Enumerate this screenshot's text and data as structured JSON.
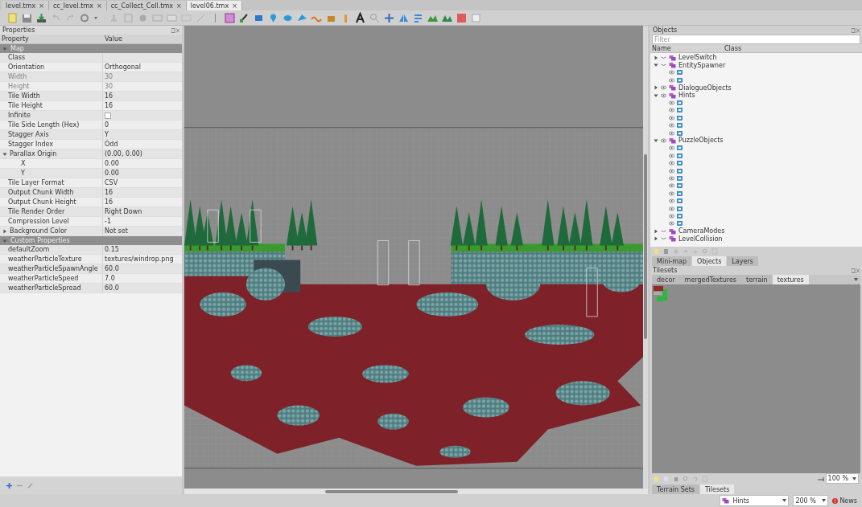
{
  "tabs": [
    {
      "label": "level.tmx",
      "close": "×",
      "selected": false
    },
    {
      "label": "cc_level.tmx",
      "close": "×",
      "selected": false
    },
    {
      "label": "cc_Collect_Cell.tmx",
      "close": "×",
      "selected": false
    },
    {
      "label": "level06.tmx",
      "close": "×",
      "selected": true
    }
  ],
  "properties": {
    "title": "Properties",
    "columns": [
      "Property",
      "Value"
    ],
    "rows": [
      {
        "kind": "group",
        "name": "Map",
        "expanded": true
      },
      {
        "kind": "prop",
        "name": "Class",
        "value": "",
        "disabled": false
      },
      {
        "kind": "prop",
        "name": "Orientation",
        "value": "Orthogonal",
        "disabled": false
      },
      {
        "kind": "prop",
        "name": "Width",
        "value": "30",
        "disabled": true
      },
      {
        "kind": "prop",
        "name": "Height",
        "value": "30",
        "disabled": true
      },
      {
        "kind": "prop",
        "name": "Tile Width",
        "value": "16",
        "disabled": false
      },
      {
        "kind": "prop",
        "name": "Tile Height",
        "value": "16",
        "disabled": false
      },
      {
        "kind": "check",
        "name": "Infinite",
        "checked": false,
        "disabled": false
      },
      {
        "kind": "prop",
        "name": "Tile Side Length (Hex)",
        "value": "0",
        "disabled": false
      },
      {
        "kind": "prop",
        "name": "Stagger Axis",
        "value": "Y",
        "disabled": false
      },
      {
        "kind": "prop",
        "name": "Stagger Index",
        "value": "Odd",
        "disabled": false
      },
      {
        "kind": "prop",
        "name": "Parallax Origin",
        "value": "(0.00, 0.00)",
        "disabled": false,
        "expanded": true
      },
      {
        "kind": "sub",
        "name": "X",
        "value": "0.00",
        "disabled": false
      },
      {
        "kind": "sub",
        "name": "Y",
        "value": "0.00",
        "disabled": false
      },
      {
        "kind": "prop",
        "name": "Tile Layer Format",
        "value": "CSV",
        "disabled": false
      },
      {
        "kind": "prop",
        "name": "Output Chunk Width",
        "value": "16",
        "disabled": false
      },
      {
        "kind": "prop",
        "name": "Output Chunk Height",
        "value": "16",
        "disabled": false
      },
      {
        "kind": "prop",
        "name": "Tile Render Order",
        "value": "Right Down",
        "disabled": false
      },
      {
        "kind": "prop",
        "name": "Compression Level",
        "value": "-1",
        "disabled": false
      },
      {
        "kind": "prop",
        "name": "Background Color",
        "value": "Not set",
        "disabled": false,
        "expanded": false
      },
      {
        "kind": "group",
        "name": "Custom Properties",
        "expanded": true
      },
      {
        "kind": "prop",
        "name": "defaultZoom",
        "value": "0.15",
        "disabled": false
      },
      {
        "kind": "prop",
        "name": "weatherParticleTexture",
        "value": "textures/windrop.png",
        "disabled": false
      },
      {
        "kind": "prop",
        "name": "weatherParticleSpawnAngle",
        "value": "60.0",
        "disabled": false
      },
      {
        "kind": "prop",
        "name": "weatherParticleSpeed",
        "value": "7.0",
        "disabled": false
      },
      {
        "kind": "prop",
        "name": "weatherParticleSpread",
        "value": "60.0",
        "disabled": false
      }
    ]
  },
  "objects": {
    "title": "Objects",
    "filter_placeholder": "Filter",
    "columns": [
      "Name",
      "Class"
    ],
    "layers": [
      {
        "name": "LevelSwitch",
        "visible": false,
        "expanded": false
      },
      {
        "name": "EntitySpawner",
        "visible": false,
        "expanded": true,
        "children": [
          {
            "visible": true
          },
          {
            "visible": true
          }
        ]
      },
      {
        "name": "DialogueObjects",
        "visible": true,
        "expanded": false
      },
      {
        "name": "Hints",
        "visible": true,
        "expanded": true,
        "children": [
          {
            "visible": true
          },
          {
            "visible": true
          },
          {
            "visible": true
          },
          {
            "visible": true
          },
          {
            "visible": true
          }
        ]
      },
      {
        "name": "PuzzleObjects",
        "visible": true,
        "expanded": true,
        "children": [
          {
            "visible": true
          },
          {
            "visible": true
          },
          {
            "visible": true
          },
          {
            "visible": true
          },
          {
            "visible": true
          },
          {
            "visible": true
          },
          {
            "visible": true
          },
          {
            "visible": true
          },
          {
            "visible": true
          },
          {
            "visible": true
          },
          {
            "visible": true
          }
        ]
      },
      {
        "name": "CameraModes",
        "visible": false,
        "expanded": false
      },
      {
        "name": "LevelCollision",
        "visible": false,
        "expanded": false
      }
    ]
  },
  "panel_tabs": [
    {
      "label": "Mini-map",
      "selected": false
    },
    {
      "label": "Objects",
      "selected": true
    },
    {
      "label": "Layers",
      "selected": false
    }
  ],
  "tilesets": {
    "title": "Tilesets",
    "tabs": [
      {
        "label": "decor",
        "selected": false
      },
      {
        "label": "mergedTextures",
        "selected": false
      },
      {
        "label": "terrain",
        "selected": false
      },
      {
        "label": "textures",
        "selected": true
      }
    ],
    "zoom": "100 %"
  },
  "bottom_tabs": [
    {
      "label": "Terrain Sets",
      "selected": false
    },
    {
      "label": "Tilesets",
      "selected": true
    }
  ],
  "status_bar": {
    "layer": "Hints",
    "zoom": "200 %",
    "news": "News"
  }
}
